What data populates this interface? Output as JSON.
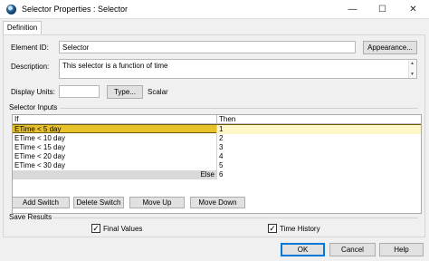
{
  "window": {
    "title": "Selector Properties : Selector",
    "minimize_glyph": "—",
    "maximize_glyph": "☐",
    "close_glyph": "✕"
  },
  "tabs": [
    {
      "label": "Definition",
      "active": true
    }
  ],
  "form": {
    "element_id_label": "Element ID:",
    "element_id_value": "Selector",
    "appearance_button": "Appearance...",
    "description_label": "Description:",
    "description_value": "This selector is a function of time",
    "display_units_label": "Display Units:",
    "display_units_value": "",
    "type_button": "Type...",
    "type_value": "Scalar"
  },
  "selector_inputs": {
    "section_label": "Selector Inputs",
    "columns": {
      "if": "If",
      "then": "Then"
    },
    "rows": [
      {
        "if": "ETime < 5 day",
        "then": "1",
        "selected": true
      },
      {
        "if": "ETime < 10 day",
        "then": "2"
      },
      {
        "if": "ETime < 15 day",
        "then": "3"
      },
      {
        "if": "ETime < 20 day",
        "then": "4"
      },
      {
        "if": "ETime < 30 day",
        "then": "5"
      }
    ],
    "else_label": "Else",
    "else_value": "6",
    "selected_row_color": "#e8c22a"
  },
  "actions": {
    "add_switch": "Add Switch",
    "delete_switch": "Delete Switch",
    "move_up": "Move Up",
    "move_down": "Move Down"
  },
  "save_results": {
    "section_label": "Save Results",
    "final_values_label": "Final Values",
    "final_values_checked": true,
    "time_history_label": "Time History",
    "time_history_checked": true,
    "check_glyph": "✓"
  },
  "dialog_buttons": {
    "ok": "OK",
    "cancel": "Cancel",
    "help": "Help"
  },
  "colors": {
    "accent": "#0078d7",
    "highlight": "#e8c22a"
  }
}
